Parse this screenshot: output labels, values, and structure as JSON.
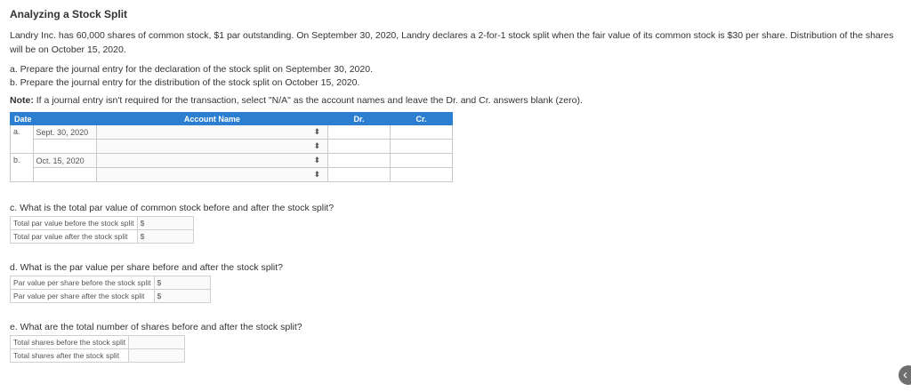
{
  "title": "Analyzing a Stock Split",
  "intro": "Landry Inc. has 60,000 shares of common stock, $1 par outstanding. On September 30, 2020, Landry declares a 2-for-1 stock split when the fair value of its common stock is $30 per share. Distribution of the shares will be on October 15, 2020.",
  "parts": {
    "a": "a. Prepare the journal entry for the declaration of the stock split on September 30, 2020.",
    "b": "b. Prepare the journal entry for the distribution of the stock split on October 15, 2020."
  },
  "note": {
    "label": "Note:",
    "text": " If a  journal entry isn't required for the transaction, select \"N/A\" as the account names and leave the Dr. and Cr. answers blank (zero)."
  },
  "journal": {
    "headers": {
      "date": "Date",
      "account": "Account Name",
      "dr": "Dr.",
      "cr": "Cr."
    },
    "entries": [
      {
        "letter": "a.",
        "date": "Sept. 30, 2020"
      },
      {
        "letter": "b.",
        "date": "Oct. 15, 2020"
      }
    ],
    "select_glyph": "⬍"
  },
  "c": {
    "question": "c. What is the total par value of common stock before and after the stock split?",
    "row1": "Total par value before the stock split",
    "row2": "Total par value after the stock split",
    "currency": "$"
  },
  "d": {
    "question": "d. What is the par value per share before and after the stock split?",
    "row1": "Par value per share before the stock split",
    "row2": "Par value per share after the stock split",
    "currency": "$"
  },
  "e": {
    "question": "e. What are the total number of shares before and after the stock split?",
    "row1": "Total shares before the stock split",
    "row2": "Total shares after the stock split"
  },
  "scroll_icon": "chevron-left-icon"
}
